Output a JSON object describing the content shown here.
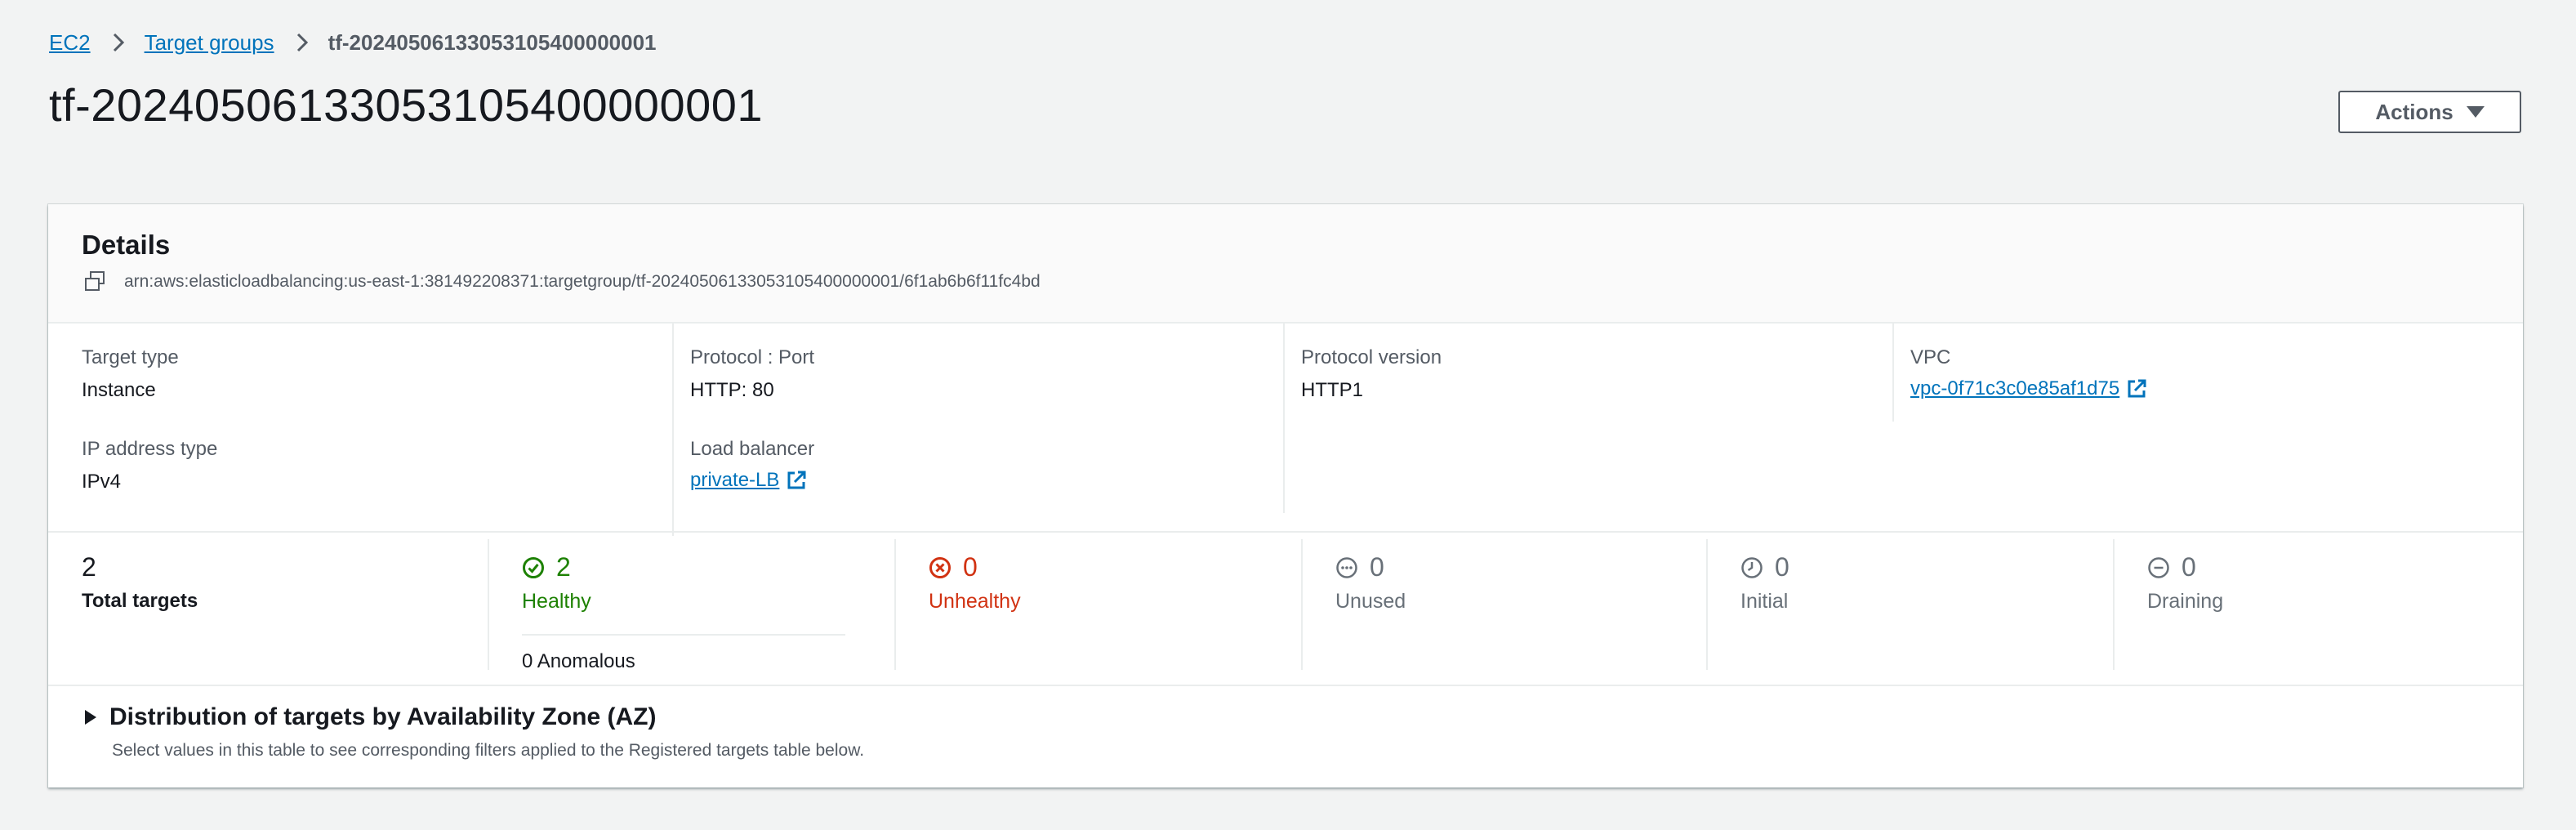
{
  "breadcrumb": {
    "items": [
      "EC2",
      "Target groups"
    ],
    "current": "tf-20240506133053105400000001"
  },
  "page": {
    "title": "tf-20240506133053105400000001",
    "actions_label": "Actions"
  },
  "details": {
    "title": "Details",
    "arn": "arn:aws:elasticloadbalancing:us-east-1:381492208371:targetgroup/tf-20240506133053105400000001/6f1ab6b6f11fc4bd",
    "target_type": {
      "label": "Target type",
      "value": "Instance"
    },
    "protocol_port": {
      "label": "Protocol : Port",
      "value": "HTTP: 80"
    },
    "protocol_version": {
      "label": "Protocol version",
      "value": "HTTP1"
    },
    "vpc": {
      "label": "VPC",
      "value": "vpc-0f71c3c0e85af1d75"
    },
    "ip_address_type": {
      "label": "IP address type",
      "value": "IPv4"
    },
    "load_balancer": {
      "label": "Load balancer",
      "value": "private-LB"
    }
  },
  "stats": {
    "total": {
      "count": "2",
      "label": "Total targets"
    },
    "healthy": {
      "count": "2",
      "label": "Healthy",
      "anomalous": "0 Anomalous"
    },
    "unhealthy": {
      "count": "0",
      "label": "Unhealthy"
    },
    "unused": {
      "count": "0",
      "label": "Unused"
    },
    "initial": {
      "count": "0",
      "label": "Initial"
    },
    "draining": {
      "count": "0",
      "label": "Draining"
    }
  },
  "distribution": {
    "title": "Distribution of targets by Availability Zone (AZ)",
    "description": "Select values in this table to see corresponding filters applied to the Registered targets table below."
  },
  "colors": {
    "link": "#0073bb",
    "healthy": "#1d8102",
    "unhealthy": "#d13212",
    "neutral": "#687078",
    "background": "#f2f3f3"
  },
  "icons": {
    "copy": "copy-icon",
    "external": "external-link-icon",
    "healthy": "check-circle-icon",
    "unhealthy": "x-circle-icon",
    "unused": "ellipsis-circle-icon",
    "initial": "clock-icon",
    "draining": "minus-circle-icon"
  }
}
